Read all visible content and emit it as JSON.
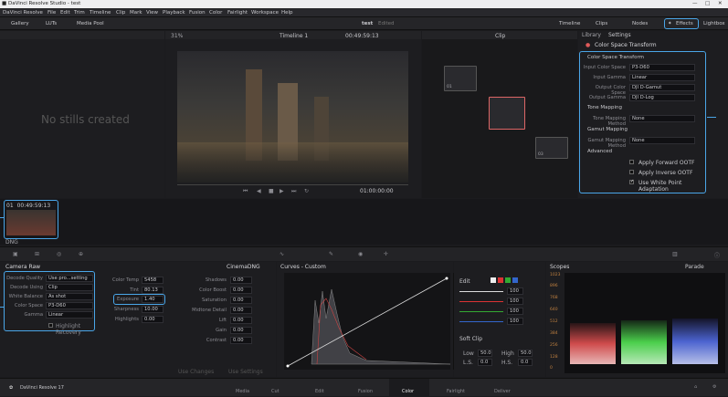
{
  "titlebar": {
    "title": "DaVinci Resolve Studio - test"
  },
  "menu": {
    "items": [
      "DaVinci Resolve",
      "File",
      "Edit",
      "Trim",
      "Timeline",
      "Clip",
      "Mark",
      "View",
      "Playback",
      "Fusion",
      "Color",
      "Fairlight",
      "Workspace",
      "Help"
    ]
  },
  "toolbar": {
    "gallery": "Gallery",
    "luts": "LUTs",
    "media_pool": "Media Pool",
    "project": "test",
    "edited": "Edited",
    "timeline": "Timeline",
    "clips": "Clips",
    "nodes": "Nodes",
    "effects": "Effects",
    "lightbox": "Lightbox"
  },
  "viewer": {
    "zoom": "31%",
    "timeline_name": "Timeline 1",
    "timecode": "00:49:59:13",
    "clip_mode": "Clip",
    "play_timecode": "01:00:00:00"
  },
  "gallery": {
    "empty_text": "No stills created"
  },
  "nodes": {
    "labels": [
      "01",
      "03"
    ]
  },
  "effects": {
    "tab_library": "Library",
    "tab_settings": "Settings",
    "title": "Color Space Transform",
    "cst_section": "Color Space Transform",
    "fields": [
      {
        "label": "Input Color Space",
        "value": "P3-D60"
      },
      {
        "label": "Input Gamma",
        "value": "Linear"
      },
      {
        "label": "Output Color Space",
        "value": "DJI D-Gamut"
      },
      {
        "label": "Output Gamma",
        "value": "DJI D-Log"
      }
    ],
    "tone_section": "Tone Mapping",
    "tone_label": "Tone Mapping Method",
    "tone_value": "None",
    "gamut_section": "Gamut Mapping",
    "gamut_label": "Gamut Mapping Method",
    "gamut_value": "None",
    "advanced_section": "Advanced",
    "checks": [
      {
        "label": "Apply Forward OOTF",
        "checked": false
      },
      {
        "label": "Apply Inverse OOTF",
        "checked": false
      },
      {
        "label": "Use White Point Adaptation",
        "checked": true
      }
    ]
  },
  "clip": {
    "number": "01",
    "timecode": "00:49:59:13",
    "codec": "DNG"
  },
  "camera_raw": {
    "title": "Camera Raw",
    "decoder_title": "CinemaDNG",
    "left": [
      {
        "label": "Decode Quality",
        "value": "Use pro...setting"
      },
      {
        "label": "Decode Using",
        "value": "Clip"
      },
      {
        "label": "White Balance",
        "value": "As shot"
      },
      {
        "label": "Color Space",
        "value": "P3-D60"
      },
      {
        "label": "Gamma",
        "value": "Linear"
      }
    ],
    "highlight_recovery": "Highlight Recovery",
    "mid": [
      {
        "label": "Color Temp",
        "value": "5458"
      },
      {
        "label": "Tint",
        "value": "80.13"
      },
      {
        "label": "Exposure",
        "value": "1.40"
      },
      {
        "label": "Sharpness",
        "value": "10.00"
      },
      {
        "label": "Highlights",
        "value": "0.00"
      }
    ],
    "right": [
      {
        "label": "Shadows",
        "value": "0.00"
      },
      {
        "label": "Color Boost",
        "value": "0.00"
      },
      {
        "label": "Saturation",
        "value": "0.00"
      },
      {
        "label": "Midtone Detail",
        "value": "0.00"
      },
      {
        "label": "Lift",
        "value": "0.00"
      },
      {
        "label": "Gain",
        "value": "0.00"
      },
      {
        "label": "Contrast",
        "value": "0.00"
      }
    ],
    "use_changes": "Use Changes",
    "use_settings": "Use Settings"
  },
  "curves": {
    "title": "Curves - Custom",
    "edit": "Edit",
    "values": [
      "100",
      "100",
      "100",
      "100"
    ],
    "soft_clip": "Soft Clip",
    "low_label": "Low",
    "low_value": "50.0",
    "high_label": "High",
    "high_value": "50.0",
    "ls_label": "L.S.",
    "ls_value": "0.0",
    "hs_label": "H.S.",
    "hs_value": "0.0"
  },
  "scopes": {
    "title": "Scopes",
    "mode": "Parade",
    "ticks": [
      "1023",
      "896",
      "768",
      "640",
      "512",
      "384",
      "256",
      "128",
      "0"
    ]
  },
  "pages": {
    "app": "DaVinci Resolve 17",
    "items": [
      "Media",
      "Cut",
      "Edit",
      "Fusion",
      "Color",
      "Fairlight",
      "Deliver"
    ],
    "active": "Color"
  },
  "colors": {
    "accent": "#4aa6e8",
    "active_page": "#ff5a1f"
  }
}
